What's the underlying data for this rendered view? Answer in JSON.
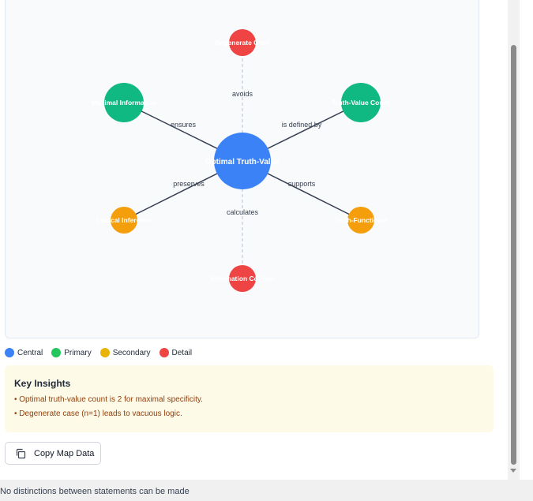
{
  "map": {
    "central": {
      "label": "Optimal Truth-Value",
      "color": "#3b82f6"
    },
    "nodes": [
      {
        "id": "degenerate",
        "label": "Degenerate Case",
        "type": "detail",
        "edge_label": "avoids",
        "edge_style": "dashed"
      },
      {
        "id": "maximal",
        "label": "Maximal Information",
        "type": "primary",
        "edge_label": "ensures",
        "edge_style": "solid"
      },
      {
        "id": "truthcount",
        "label": "Truth-Value Count",
        "type": "primary",
        "edge_label": "is defined by",
        "edge_style": "solid"
      },
      {
        "id": "logical",
        "label": "Logical Inference",
        "type": "secondary",
        "edge_label": "preserves",
        "edge_style": "solid"
      },
      {
        "id": "functional",
        "label": "Truth-Functional",
        "type": "secondary",
        "edge_label": "supports",
        "edge_style": "solid"
      },
      {
        "id": "information",
        "label": "Information Content",
        "type": "detail",
        "edge_label": "calculates",
        "edge_style": "dashed"
      }
    ]
  },
  "colors": {
    "central": "#3b82f6",
    "primary": "#10b981",
    "secondary": "#f59e0b",
    "detail": "#ef4444"
  },
  "legend": [
    {
      "label": "Central",
      "color": "#3b82f6"
    },
    {
      "label": "Primary",
      "color": "#22c55e"
    },
    {
      "label": "Secondary",
      "color": "#eab308"
    },
    {
      "label": "Detail",
      "color": "#ef4444"
    }
  ],
  "insights": {
    "title": "Key Insights",
    "items": [
      "• Optimal truth-value count is 2 for maximal specificity.",
      "• Degenerate case (n=1) leads to vacuous logic."
    ]
  },
  "copy_button": {
    "label": "Copy Map Data",
    "icon": "copy-icon"
  },
  "footer_text": "No distinctions between statements can be made"
}
